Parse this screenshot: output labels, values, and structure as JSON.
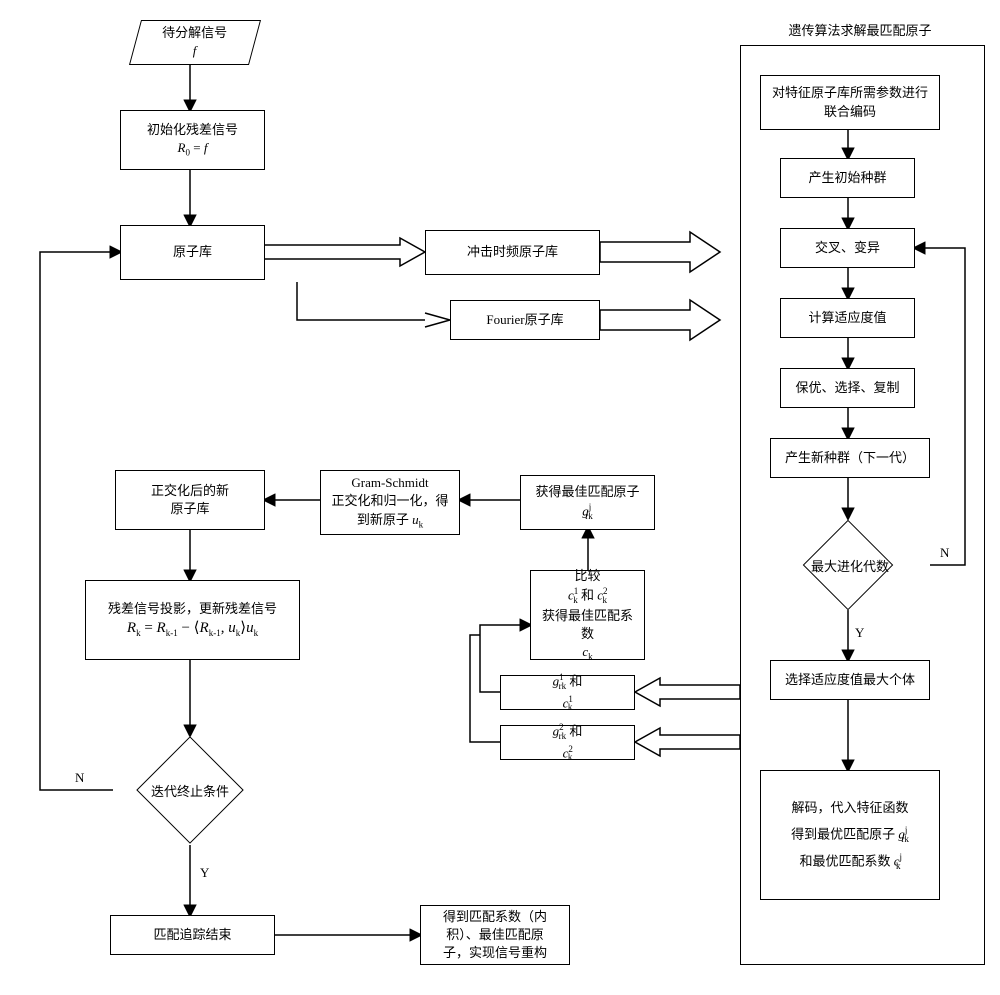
{
  "input": {
    "line1": "待分解信号",
    "line2_sym": "f"
  },
  "init": {
    "line1": "初始化残差信号",
    "line2_sym": "R",
    "line2_sub": "0",
    "line2_eq": " = ",
    "line2_rhs": "f"
  },
  "atom_lib": "原子库",
  "impact_atom": "冲击时频原子库",
  "fourier_atom": "Fourier原子库",
  "ortho_new_lib": {
    "l1": "正交化后的新",
    "l2": "原子库"
  },
  "gram_schmidt": {
    "l1": "Gram-Schmidt",
    "l2": "正交化和归一化，得",
    "l3a": "到新原子  ",
    "l3_sym": "u",
    "l3_sub": "k"
  },
  "best_atom": {
    "l1": "获得最佳匹配原子",
    "sym": "g",
    "sub": "rk",
    "sup": "j"
  },
  "compare": {
    "l1": "比较",
    "c1_sym": "c",
    "c1_sub": "k",
    "c1_sup": "1",
    "and": " 和 ",
    "c2_sym": "c",
    "c2_sub": "k",
    "c2_sup": "2",
    "l3": "获得最佳匹配系数",
    "ck_sym": "c",
    "ck_sub": "k"
  },
  "pair1": {
    "g_sym": "g",
    "g_sub": "rk",
    "g_sup": "1",
    "and": " 和 ",
    "c_sym": "c",
    "c_sub": "k",
    "c_sup": "1"
  },
  "pair2": {
    "g_sym": "g",
    "g_sub": "rk",
    "g_sup": "2",
    "and": " 和 ",
    "c_sym": "c",
    "c_sub": "k",
    "c_sup": "2"
  },
  "residual_update": {
    "l1": "残差信号投影，更新残差信号",
    "eq_prefix": "R",
    "eq_sub1": "k",
    "eq_mid1": " = ",
    "eq_R2": "R",
    "eq_sub2": "k-1",
    "eq_mid2": " − ⟨",
    "eq_R3": "R",
    "eq_sub3": "k-1",
    "eq_comma": ", ",
    "eq_u1": "u",
    "eq_usub1": "k",
    "eq_close": "⟩",
    "eq_u2": "u",
    "eq_usub2": "k"
  },
  "iter_stop": "迭代终止条件",
  "mp_end": "匹配追踪结束",
  "mp_result": {
    "l1": "得到匹配系数（内",
    "l2": "积）、最佳匹配原",
    "l3": "子，实现信号重构"
  },
  "ga_title": "遗传算法求解最匹配原子",
  "ga": {
    "encode": {
      "l1": "对特征原子库所需参数进行",
      "l2": "联合编码"
    },
    "init_pop": "产生初始种群",
    "cross_mut": "交叉、变异",
    "fitness": "计算适应度值",
    "select": "保优、选择、复制",
    "new_pop": "产生新种群（下一代）",
    "max_gen": "最大进化代数",
    "pick_best": "选择适应度值最大个体",
    "decode": {
      "l1": "解码，代入特征函数",
      "l2a": "得到最优匹配原子 ",
      "g_sym": "g",
      "g_sub": "rk",
      "g_sup": "j",
      "l3a": "和最优匹配系数  ",
      "c_sym": "c",
      "c_sub": "k",
      "c_sup": "j"
    }
  },
  "labels": {
    "Y": "Y",
    "N": "N"
  }
}
